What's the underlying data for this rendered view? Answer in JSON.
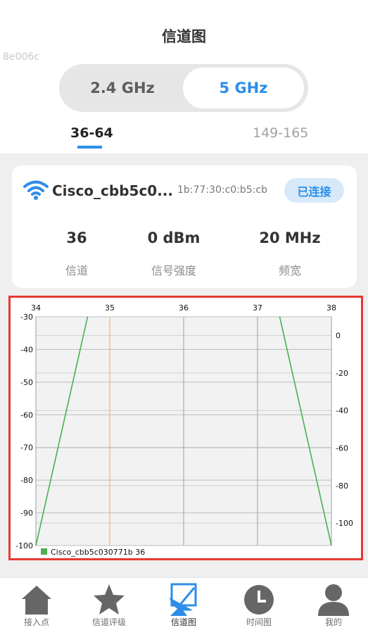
{
  "page": {
    "title": "信道图",
    "watermark": "8e006c"
  },
  "band_tabs": {
    "tab_24": "2.4 GHz",
    "tab_5": "5 GHz",
    "selected": "5 GHz"
  },
  "range_tabs": {
    "tab_1": "36-64",
    "tab_2": "149-165",
    "selected": "36-64"
  },
  "network_card": {
    "ssid": "Cisco_cbb5c0...",
    "bssid": "1b:77:30:c0:b5:cb",
    "status": "已连接",
    "stats": [
      {
        "value": "36",
        "label": "信道"
      },
      {
        "value": "0 dBm",
        "label": "信号强度"
      },
      {
        "value": "20 MHz",
        "label": "频宽"
      }
    ]
  },
  "colors": {
    "accent": "#2d8ee8",
    "series_green": "#4caf50",
    "marker_orange": "#f5b26b",
    "highlight_border": "#e53935"
  },
  "chart_data": {
    "type": "line",
    "x_top_ticks": [
      "34",
      "35",
      "36",
      "37",
      "38"
    ],
    "x_range": [
      34,
      38
    ],
    "left_axis": {
      "ticks": [
        "-30",
        "-40",
        "-50",
        "-60",
        "-70",
        "-80",
        "-90",
        "-100"
      ],
      "range": [
        -100,
        -30
      ]
    },
    "right_axis": {
      "ticks": [
        "0",
        "-20",
        "-40",
        "-60",
        "-80",
        "-100"
      ],
      "range": [
        -112,
        10
      ]
    },
    "vertical_marker": 35,
    "series": [
      {
        "name": "Cisco_cbb5c030771b 36",
        "points": [
          [
            34,
            -100
          ],
          [
            34.7,
            -30
          ]
        ],
        "color": "#4caf50"
      },
      {
        "name": "Cisco_cbb5c030771b 36",
        "points": [
          [
            37.3,
            -30
          ],
          [
            38,
            -100
          ]
        ],
        "color": "#4caf50"
      }
    ],
    "legend": {
      "label": "Cisco_cbb5c030771b 36",
      "position": "bottom-left"
    },
    "grid": true
  },
  "bottom_nav": {
    "items": [
      {
        "label": "接入点",
        "icon": "home-icon"
      },
      {
        "label": "信道评级",
        "icon": "star-icon"
      },
      {
        "label": "信道图",
        "icon": "radar-dish-icon"
      },
      {
        "label": "时间图",
        "icon": "clock-icon"
      },
      {
        "label": "我的",
        "icon": "user-icon"
      }
    ],
    "active_index": 2
  }
}
